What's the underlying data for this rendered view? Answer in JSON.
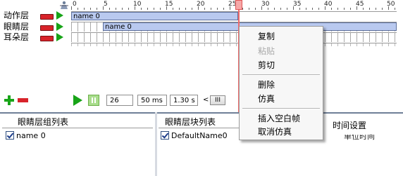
{
  "timeline": {
    "ruler_numbers": [
      "0",
      "5",
      "10",
      "15",
      "20",
      "25",
      "30",
      "35",
      "40",
      "45",
      "50"
    ],
    "layers": [
      {
        "name": "动作层",
        "clip_label": "name 0"
      },
      {
        "name": "眼睛层",
        "clip_label": "name 0"
      },
      {
        "name": "耳朵层",
        "clip_label": ""
      }
    ]
  },
  "controls": {
    "frame_value": "26",
    "interval_value": "50 ms",
    "duration_value": "1.30 s",
    "scroll_arrow": "<",
    "scroll_thumb": "III"
  },
  "context_menu": {
    "items": [
      "复制",
      "粘贴",
      "剪切",
      "删除",
      "仿真",
      "插入空白帧",
      "取消仿真"
    ],
    "disabled": [
      "粘贴"
    ]
  },
  "panels": {
    "group_list": {
      "title": "眼睛层组列表",
      "items": [
        "name 0"
      ]
    },
    "block_list": {
      "title": "眼睛层块列表",
      "items": [
        "DefaultName0"
      ]
    },
    "time_settings": {
      "title": "时间设置",
      "cut_text": "单位时间"
    }
  },
  "colors": {
    "add_button": "#19a519",
    "remove_button": "#d8232a",
    "play_button": "#18a418",
    "clip_fill": "#b9c9ef",
    "playhead": "#ef6a6a",
    "panel_border": "#6f7f97"
  },
  "icons": {
    "top_left": "person-icon",
    "add": "plus-icon",
    "remove": "minus-icon",
    "play": "play-icon",
    "pause": "pause-icon"
  }
}
